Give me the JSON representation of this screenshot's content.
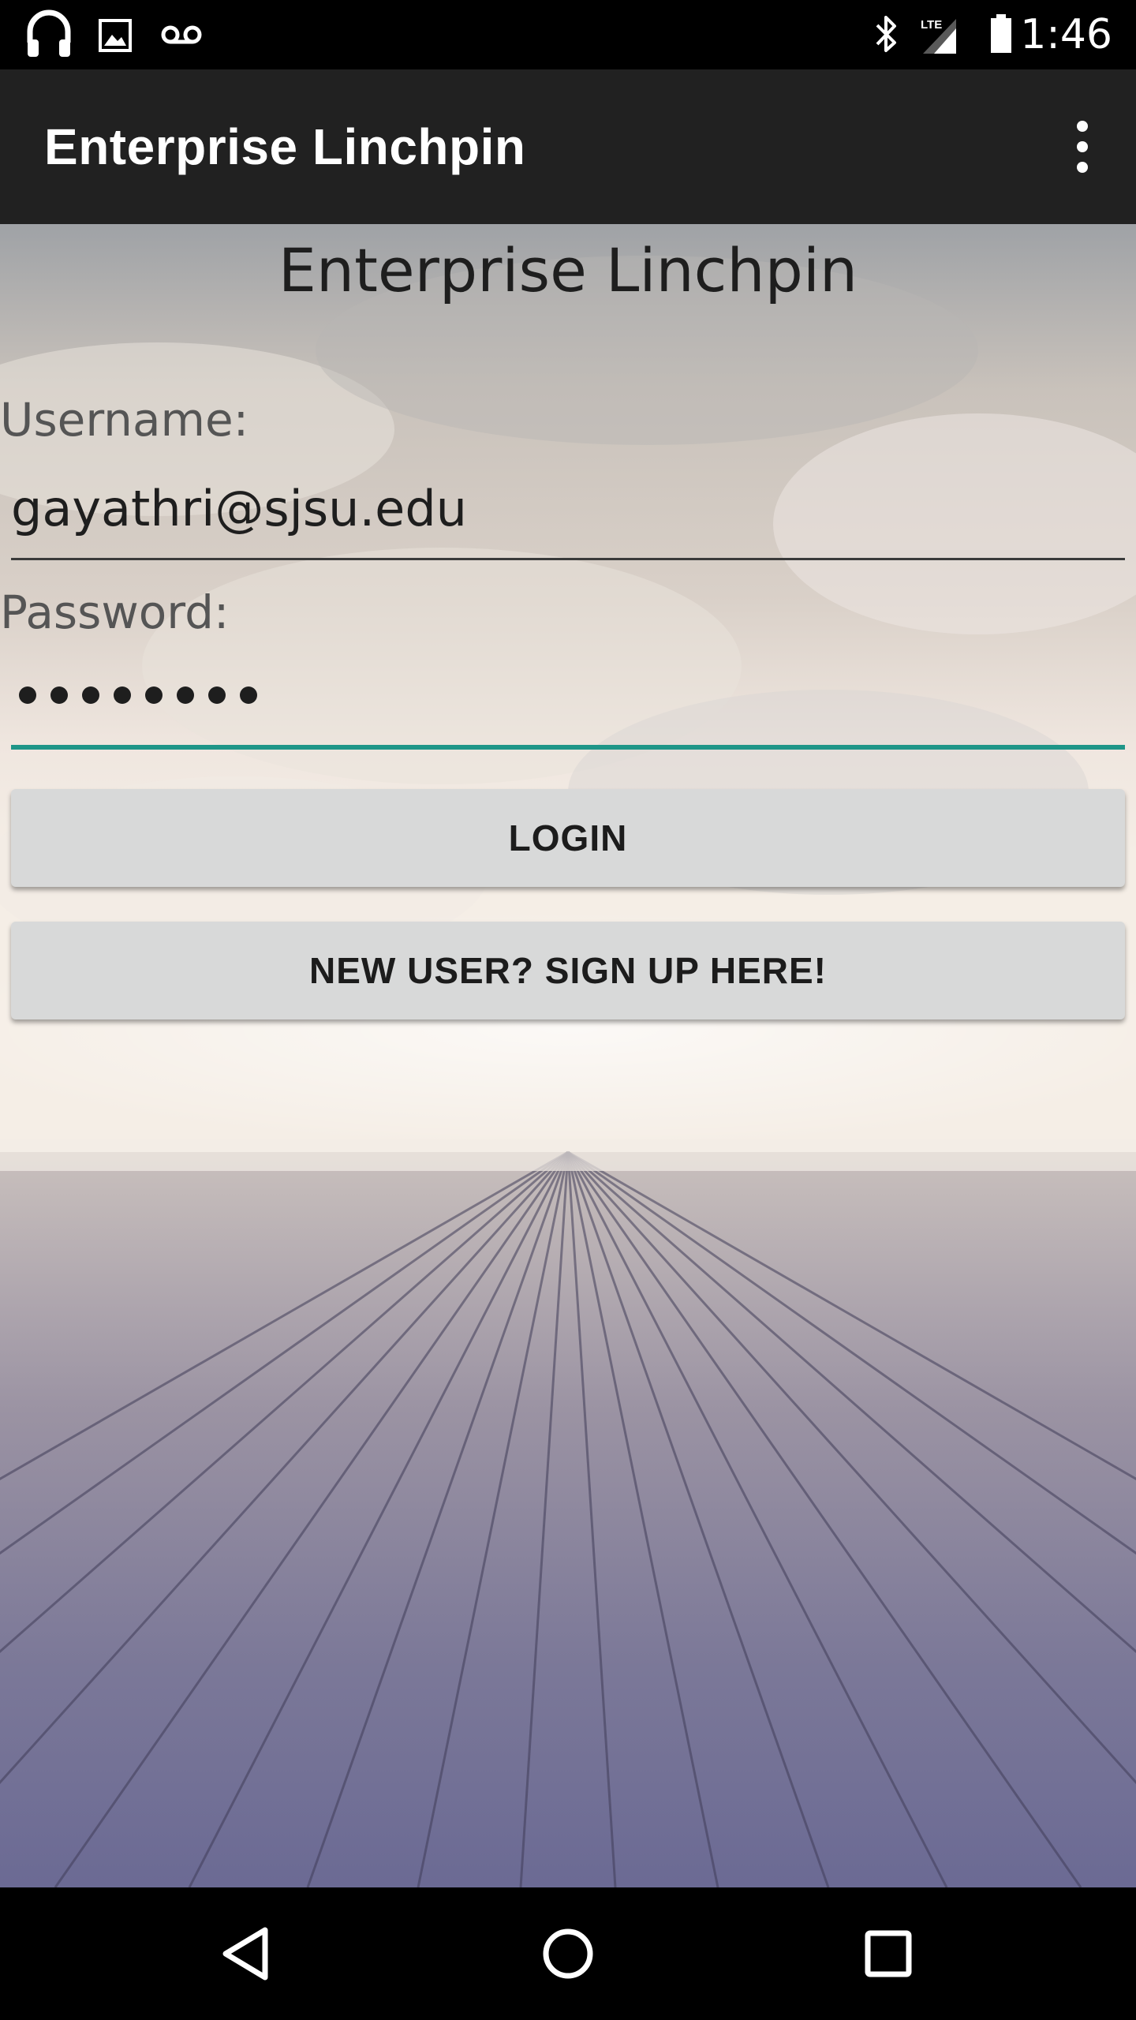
{
  "status_bar": {
    "time": "1:46",
    "network_label": "LTE",
    "icons": [
      "headphones-icon",
      "image-icon",
      "voicemail-icon",
      "bluetooth-icon",
      "cellular-signal-icon",
      "battery-icon"
    ]
  },
  "app_bar": {
    "title": "Enterprise Linchpin",
    "menu_icon": "overflow-menu-icon"
  },
  "form": {
    "heading": "Enterprise Linchpin",
    "username_label": "Username:",
    "username_value": "gayathri@sjsu.edu",
    "password_label": "Password:",
    "password_masked_length": 8,
    "login_label": "LOGIN",
    "signup_label": "NEW USER? SIGN UP HERE!"
  },
  "nav_bar": {
    "icons": [
      "back-icon",
      "home-icon",
      "recents-icon"
    ]
  },
  "colors": {
    "app_bar": "#212121",
    "accent": "#1e9688",
    "button": "#d8d9d9"
  }
}
